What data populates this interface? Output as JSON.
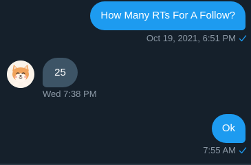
{
  "messages": [
    {
      "text": "How Many RTs For A Follow?",
      "timestamp": "Oct 19, 2021, 6:51 PM",
      "direction": "sent",
      "status_icon": "check-icon"
    },
    {
      "text": "25",
      "timestamp": "Wed 7:38 PM",
      "direction": "received",
      "avatar_icon": "shiba-dog-avatar"
    },
    {
      "text": "Ok",
      "timestamp": "7:55 AM",
      "direction": "sent",
      "status_icon": "check-icon"
    }
  ],
  "colors": {
    "background": "#15202b",
    "sent_bubble": "#1d9bf0",
    "received_bubble": "#3d5466",
    "meta_text": "#8b98a5",
    "check": "#1d9bf0"
  }
}
